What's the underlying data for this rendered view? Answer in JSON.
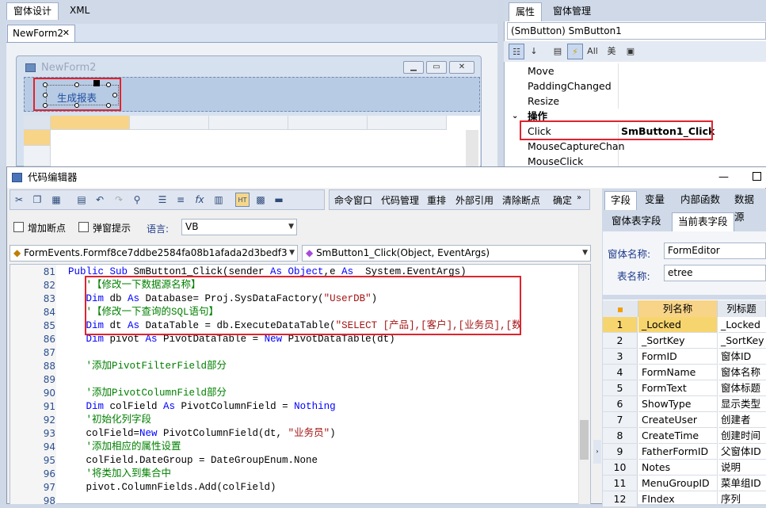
{
  "designer": {
    "tabs": [
      "窗体设计",
      "XML"
    ],
    "doc_tab": "NewForm2",
    "form_title": "NewForm2",
    "button_label": "生成报表"
  },
  "properties": {
    "tabs": [
      "属性",
      "窗体管理"
    ],
    "selected_object": "(SmButton) SmButton1",
    "toolbar_labels": [
      "All",
      "美"
    ],
    "rows": [
      {
        "name": "Move",
        "value": ""
      },
      {
        "name": "PaddingChanged",
        "value": ""
      },
      {
        "name": "Resize",
        "value": ""
      },
      {
        "name": "操作",
        "value": "",
        "category": true
      },
      {
        "name": "Click",
        "value": "SmButton1_Click"
      },
      {
        "name": "MouseCaptureChan",
        "value": ""
      },
      {
        "name": "MouseClick",
        "value": ""
      }
    ]
  },
  "code_editor": {
    "title": "代码编辑器",
    "toolbar2": [
      "命令窗口",
      "代码管理",
      "重排",
      "外部引用",
      "清除断点",
      "确定"
    ],
    "add_breakpoint": "增加断点",
    "popup_hint": "弹窗提示",
    "language_label": "语言:",
    "language_value": "VB",
    "events_combo": "FormEvents.Formf8ce7ddbe2584fa08b1afada2d3bedf3",
    "method_combo": "SmButton1_Click(Object, EventArgs)",
    "line_numbers": [
      "81",
      "82",
      "83",
      "84",
      "85",
      "86",
      "87",
      "88",
      "89",
      "90",
      "91",
      "92",
      "93",
      "94",
      "95",
      "96",
      "97",
      "98"
    ],
    "lines": [
      [
        {
          "t": "Public Sub ",
          "c": "kw"
        },
        {
          "t": "SmButton1_Click(sender ",
          "c": ""
        },
        {
          "t": "As Object",
          "c": "kw"
        },
        {
          "t": ",e ",
          "c": ""
        },
        {
          "t": "As",
          "c": "kw"
        },
        {
          "t": "  System.EventArgs)",
          "c": ""
        }
      ],
      [
        {
          "t": "   '【修改一下数据源名称】",
          "c": "cm"
        }
      ],
      [
        {
          "t": "   Dim ",
          "c": "kw"
        },
        {
          "t": "db ",
          "c": ""
        },
        {
          "t": "As ",
          "c": "kw"
        },
        {
          "t": "Database= Proj.SysDataFactory(",
          "c": ""
        },
        {
          "t": "\"UserDB\"",
          "c": "str"
        },
        {
          "t": ")",
          "c": ""
        }
      ],
      [
        {
          "t": "   '【修改一下查询的SQL语句】",
          "c": "cm"
        }
      ],
      [
        {
          "t": "   Dim ",
          "c": "kw"
        },
        {
          "t": "dt ",
          "c": ""
        },
        {
          "t": "As ",
          "c": "kw"
        },
        {
          "t": "DataTable = db.ExecuteDataTable(",
          "c": ""
        },
        {
          "t": "\"SELECT [产品],[客户],[业务员],[数",
          "c": "str"
        }
      ],
      [
        {
          "t": "   Dim ",
          "c": "kw"
        },
        {
          "t": "pivot ",
          "c": ""
        },
        {
          "t": "As ",
          "c": "kw"
        },
        {
          "t": "PivotDataTable = ",
          "c": ""
        },
        {
          "t": "New ",
          "c": "kw"
        },
        {
          "t": "PivotDataTable(dt)",
          "c": ""
        }
      ],
      [
        {
          "t": "",
          "c": ""
        }
      ],
      [
        {
          "t": "   '添加PivotFilterField部分",
          "c": "cm"
        }
      ],
      [
        {
          "t": "",
          "c": ""
        }
      ],
      [
        {
          "t": "   '添加PivotColumnField部分",
          "c": "cm"
        }
      ],
      [
        {
          "t": "   Dim ",
          "c": "kw"
        },
        {
          "t": "colField ",
          "c": ""
        },
        {
          "t": "As ",
          "c": "kw"
        },
        {
          "t": "PivotColumnField = ",
          "c": ""
        },
        {
          "t": "Nothing",
          "c": "kw"
        }
      ],
      [
        {
          "t": "   '初始化列字段",
          "c": "cm"
        }
      ],
      [
        {
          "t": "   colField=",
          "c": ""
        },
        {
          "t": "New ",
          "c": "kw"
        },
        {
          "t": "PivotColumnField(dt, ",
          "c": ""
        },
        {
          "t": "\"业务员\"",
          "c": "str"
        },
        {
          "t": ")",
          "c": ""
        }
      ],
      [
        {
          "t": "   '添加相应的属性设置",
          "c": "cm"
        }
      ],
      [
        {
          "t": "   colField.DateGroup = DateGroupEnum.None",
          "c": ""
        }
      ],
      [
        {
          "t": "   '将类加入到集合中",
          "c": "cm"
        }
      ],
      [
        {
          "t": "   pivot.ColumnFields.Add(colField)",
          "c": ""
        }
      ],
      [
        {
          "t": "",
          "c": ""
        }
      ]
    ]
  },
  "field_panel": {
    "tabs": [
      "字段",
      "变量",
      "内部函数",
      "数据源"
    ],
    "subtabs": [
      "窗体表字段",
      "当前表字段"
    ],
    "form_name_label": "窗体名称:",
    "form_name_value": "FormEditor",
    "table_name_label": "表名称:",
    "table_name_value": "etree",
    "columns": [
      "列名称",
      "列标题"
    ],
    "rows": [
      {
        "n": "1",
        "name": "_Locked",
        "title": "_Locked"
      },
      {
        "n": "2",
        "name": "_SortKey",
        "title": "_SortKey"
      },
      {
        "n": "3",
        "name": "FormID",
        "title": "窗体ID"
      },
      {
        "n": "4",
        "name": "FormName",
        "title": "窗体名称"
      },
      {
        "n": "5",
        "name": "FormText",
        "title": "窗体标题"
      },
      {
        "n": "6",
        "name": "ShowType",
        "title": "显示类型"
      },
      {
        "n": "7",
        "name": "CreateUser",
        "title": "创建者"
      },
      {
        "n": "8",
        "name": "CreateTime",
        "title": "创建时间"
      },
      {
        "n": "9",
        "name": "FatherFormID",
        "title": "父窗体ID"
      },
      {
        "n": "10",
        "name": "Notes",
        "title": "说明"
      },
      {
        "n": "11",
        "name": "MenuGroupID",
        "title": "菜单组ID"
      },
      {
        "n": "12",
        "name": "FIndex",
        "title": "序列"
      }
    ]
  }
}
